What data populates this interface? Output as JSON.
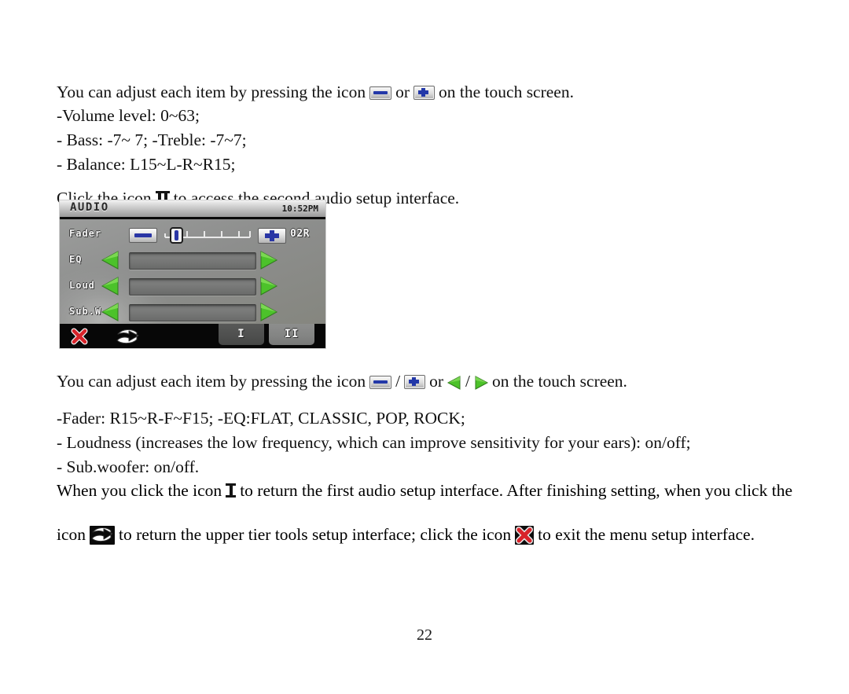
{
  "document": {
    "page_number": "22",
    "paragraphs": {
      "adjust_first_a": "You can adjust each item by pressing the icon",
      "adjust_first_or": "or",
      "adjust_first_b": "on the touch screen.",
      "volume": "-Volume level: 0~63;",
      "bass": "- Bass: -7~ 7; -Treble: -7~7;",
      "balance": "- Balance: L15~L-R~R15;",
      "click_icon_a": "Click the icon",
      "click_icon_b": "to access the second audio setup interface.",
      "adjust_second_a": "You can adjust each item by pressing the icon",
      "adjust_second_slash": "/",
      "adjust_second_or": "or",
      "adjust_second_b": "on the touch screen.",
      "fader": "-Fader: R15~R-F~F15; -EQ:FLAT, CLASSIC, POP, ROCK;",
      "loudness": "- Loudness (increases the low frequency, which can improve sensitivity for your ears): on/off;",
      "subwoofer": "- Sub.woofer: on/off.",
      "final_a": "When you click the icon",
      "final_b": "to return the first audio setup interface. After finishing setting, when you click the",
      "final_c": "icon",
      "final_d": "to return the upper tier tools setup interface; click the icon",
      "final_e": "to exit the menu setup interface."
    },
    "icon_names": {
      "minus": "minus-button-icon",
      "plus": "plus-button-icon",
      "arrow_left": "green-left-arrow-icon",
      "arrow_right": "green-right-arrow-icon",
      "roman_one": "roman-numeral-one-icon",
      "roman_two": "roman-numeral-two-icon",
      "return": "return-arrow-icon",
      "exit": "exit-x-icon"
    }
  },
  "device_screenshot": {
    "title": "AUDIO",
    "time": "10:52PM",
    "rows": [
      {
        "label": "Fader",
        "value": "02R",
        "control": "slider"
      },
      {
        "label": "EQ",
        "value": "",
        "control": "arrows"
      },
      {
        "label": "Loud",
        "value": "",
        "control": "arrows"
      },
      {
        "label": "Sub.W",
        "value": "",
        "control": "arrows"
      }
    ],
    "bottom_bar": {
      "exit_label": "exit",
      "return_label": "return",
      "tab_one": "I",
      "tab_two": "II"
    },
    "colors": {
      "accent_blue": "#2a36a5",
      "arrow_green": "#4cc22a",
      "exit_red": "#d8232a",
      "screen_gray": "#8f908f",
      "bar_black": "#070707"
    }
  }
}
